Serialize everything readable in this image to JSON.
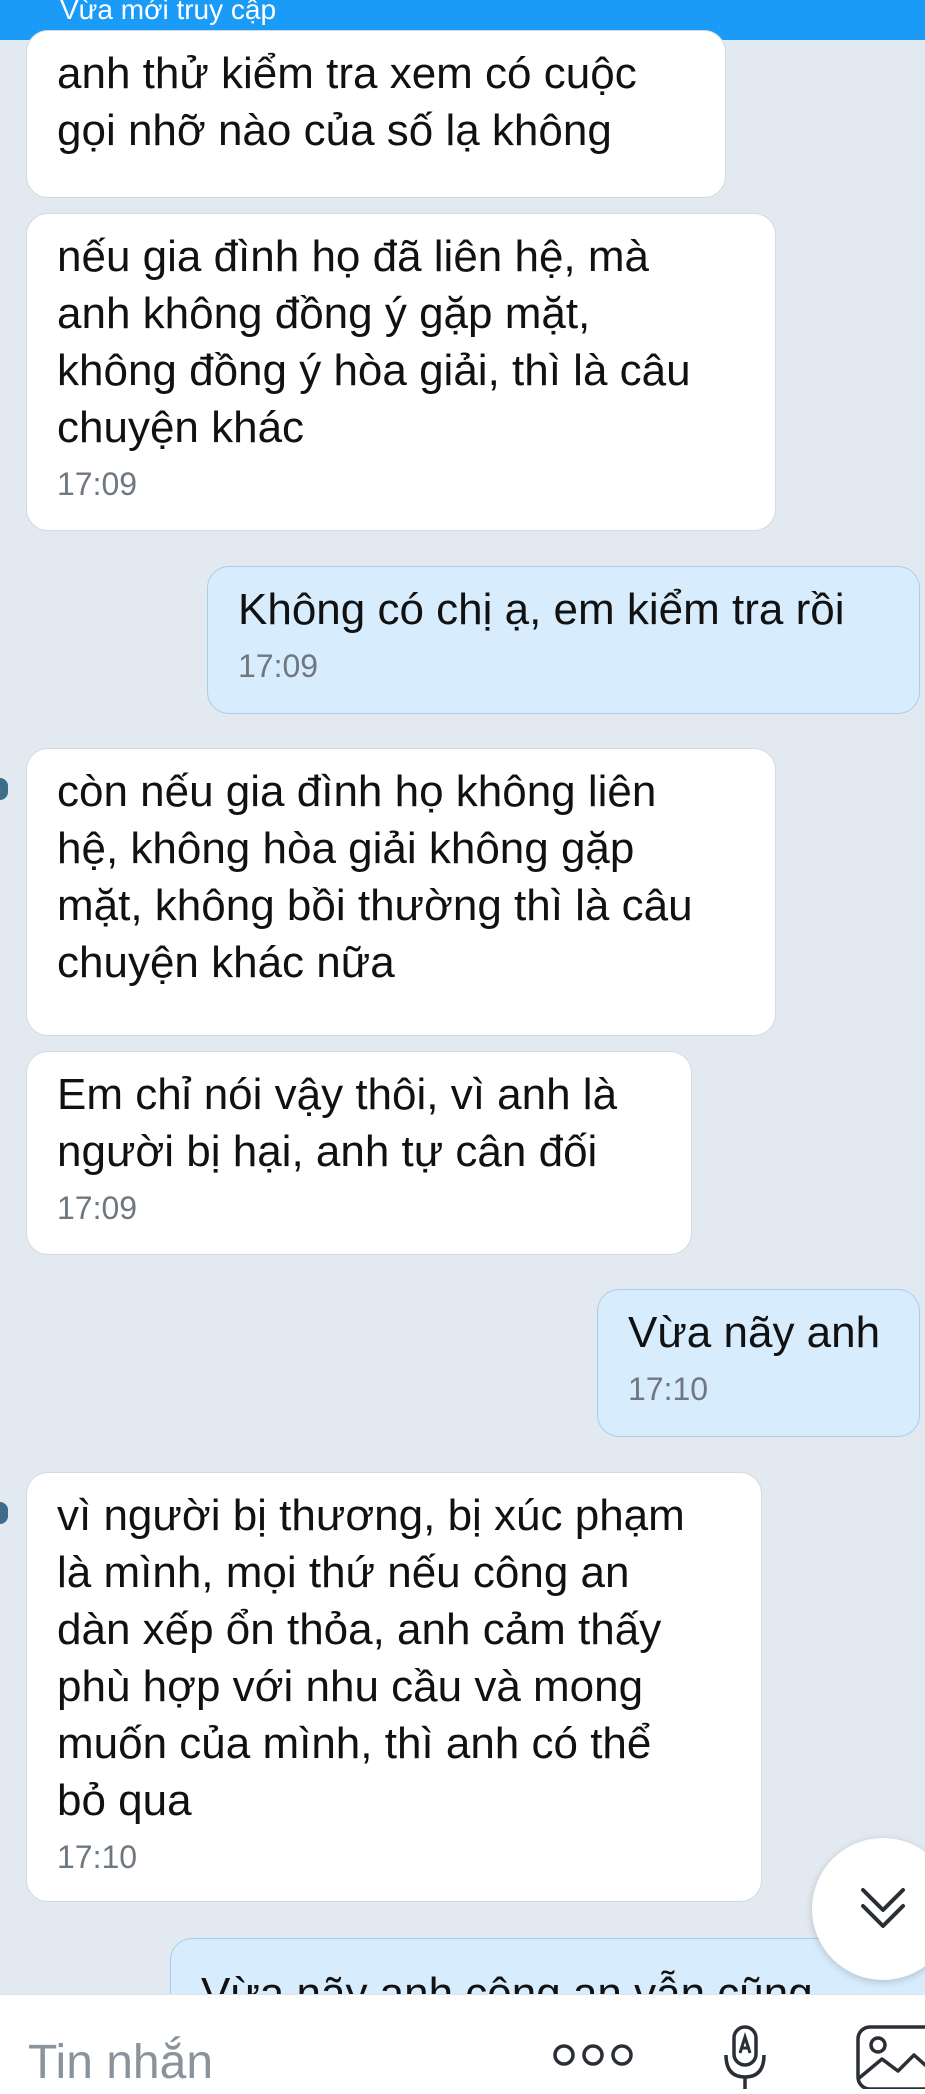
{
  "status_bar": {
    "text": "Vừa mới truy cập"
  },
  "messages": [
    {
      "side": "in",
      "text": "anh thử kiểm tra xem có cuộc\ngọi nhỡ nào của số lạ không",
      "time": ""
    },
    {
      "side": "in",
      "text": "nếu gia đình họ đã liên hệ, mà\nanh không đồng ý gặp mặt,\nkhông đồng ý hòa giải, thì là câu\nchuyện khác",
      "time": "17:09"
    },
    {
      "side": "out",
      "text": "Không có chị ạ, em kiểm tra rồi",
      "time": "17:09"
    },
    {
      "side": "in",
      "text": "còn nếu gia đình họ không liên\nhệ, không hòa giải không gặp\nmặt, không bồi thường thì là câu\nchuyện khác nữa",
      "time": ""
    },
    {
      "side": "in",
      "text": "Em chỉ nói vậy thôi, vì anh là\nngười bị hại, anh tự cân đối",
      "time": "17:09"
    },
    {
      "side": "out",
      "text": "Vừa nãy anh",
      "time": "17:10"
    },
    {
      "side": "in",
      "text": "vì người bị thương, bị xúc phạm\nlà mình, mọi thứ nếu công an\ndàn xếp ổn thỏa, anh cảm thấy\nphù hợp với nhu cầu và mong\nmuốn của mình, thì anh có thể\nbỏ qua",
      "time": "17:10"
    },
    {
      "side": "out",
      "text": "Vừa nãy anh công an vẫn cũng",
      "time": ""
    }
  ],
  "composer": {
    "placeholder": "Tin nhắn"
  },
  "icons": {
    "scroll_down": "double-chevron-down-icon",
    "more": "more-dots-icon",
    "voice": "microphone-icon",
    "image": "image-icon"
  },
  "colors": {
    "status_bar": "#1a9bf7",
    "background": "#e2e9f1",
    "incoming_bubble": "#ffffff",
    "outgoing_bubble": "#d7ecfc"
  }
}
